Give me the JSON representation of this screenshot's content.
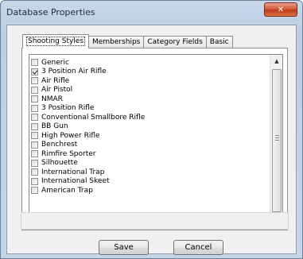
{
  "window": {
    "title": "Database Properties",
    "close_glyph": "✕"
  },
  "tabs": [
    {
      "label": "Shooting Styles",
      "active": true
    },
    {
      "label": "Memberships",
      "active": false
    },
    {
      "label": "Category Fields",
      "active": false
    },
    {
      "label": "Basic",
      "active": false
    }
  ],
  "shooting_styles": [
    {
      "label": "Generic",
      "checked": false
    },
    {
      "label": "3 Position Air Rifle",
      "checked": true
    },
    {
      "label": "Air Rifle",
      "checked": false
    },
    {
      "label": "Air Pistol",
      "checked": false
    },
    {
      "label": "NMAR",
      "checked": false
    },
    {
      "label": "3 Position Rifle",
      "checked": false
    },
    {
      "label": "Conventional Smallbore Rifle",
      "checked": false
    },
    {
      "label": "BB Gun",
      "checked": false
    },
    {
      "label": "High Power Rifle",
      "checked": false
    },
    {
      "label": "Benchrest",
      "checked": false
    },
    {
      "label": "Rimfire Sporter",
      "checked": false
    },
    {
      "label": "Silhouette",
      "checked": false
    },
    {
      "label": "International Trap",
      "checked": false
    },
    {
      "label": "International Skeet",
      "checked": false
    },
    {
      "label": "American Trap",
      "checked": false
    }
  ],
  "scrollbar": {
    "up_glyph": "▲",
    "down_glyph": "▼"
  },
  "buttons": {
    "save": "Save",
    "cancel": "Cancel"
  }
}
